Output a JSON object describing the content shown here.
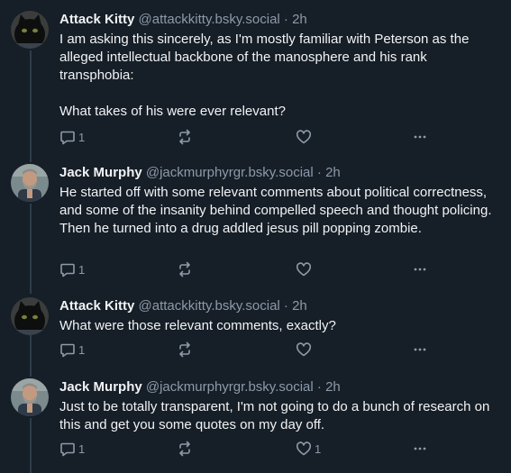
{
  "posts": [
    {
      "author": "Attack Kitty",
      "handle": "@attackkitty.bsky.social",
      "separator": "·",
      "time": "2h",
      "text": "I am asking this sincerely, as I'm mostly familiar with Peterson as the alleged intellectual backbone of the manosphere and his rank transphobia:\n\nWhat takes of his were ever relevant?",
      "reply_count": "1",
      "like_count": "",
      "avatar_icon": "black-cat-avatar"
    },
    {
      "author": "Jack Murphy",
      "handle": "@jackmurphyrgr.bsky.social",
      "separator": "·",
      "time": "2h",
      "text": "He started off with some relevant comments about political correctness, and some of the insanity behind compelled speech and thought policing. Then he turned into a drug addled jesus pill popping zombie.",
      "reply_count": "1",
      "like_count": "",
      "avatar_icon": "man-portrait-avatar"
    },
    {
      "author": "Attack Kitty",
      "handle": "@attackkitty.bsky.social",
      "separator": "·",
      "time": "2h",
      "text": "What were those relevant comments, exactly?",
      "reply_count": "1",
      "like_count": "",
      "avatar_icon": "black-cat-avatar"
    },
    {
      "author": "Jack Murphy",
      "handle": "@jackmurphyrgr.bsky.social",
      "separator": "·",
      "time": "2h",
      "text": "Just to be totally transparent, I'm not going to do a bunch of research on this and get you some quotes on my day off.",
      "reply_count": "1",
      "like_count": "1",
      "avatar_icon": "man-portrait-avatar"
    }
  ],
  "icons": {
    "reply": "reply-bubble-icon",
    "repost": "repost-arrows-icon",
    "like": "heart-icon",
    "more": "more-dots-icon"
  },
  "colors": {
    "background": "#161e27",
    "text": "#f1f3f5",
    "muted": "#8d9aaa",
    "thread_line": "#2e3c4a"
  }
}
